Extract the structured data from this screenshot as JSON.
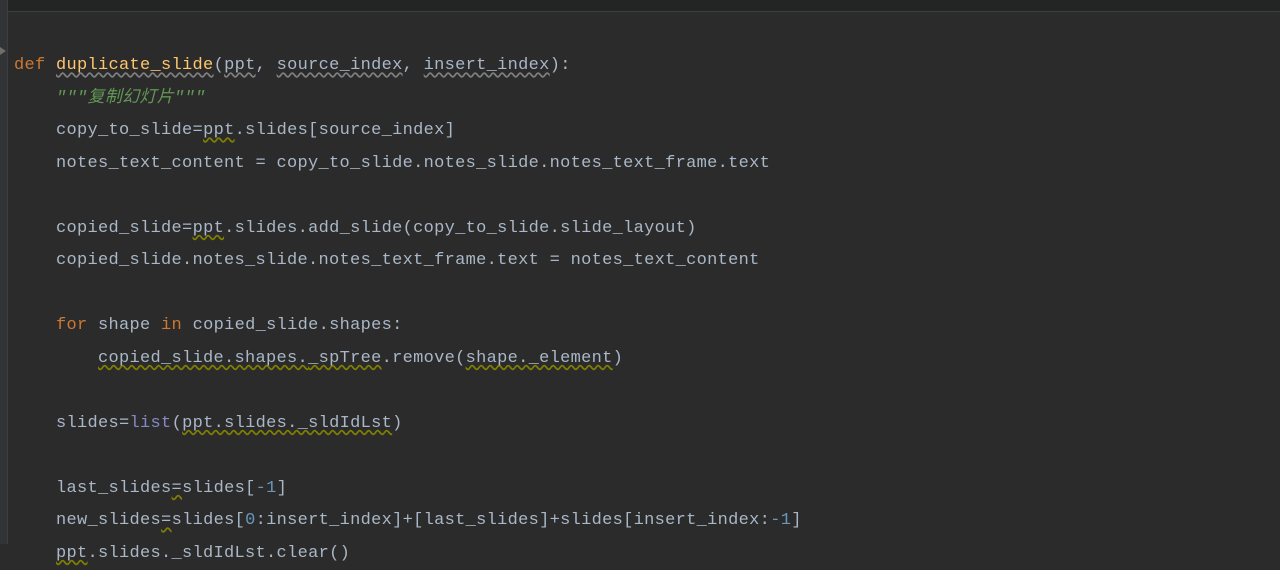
{
  "code": {
    "line1_def": "def",
    "line1_space": " ",
    "line1_fname": "duplicate_slide",
    "line1_open": "(",
    "line1_param1": "ppt",
    "line1_comma1": ", ",
    "line1_param2": "source_index",
    "line1_comma2": ", ",
    "line1_param3": "insert_index",
    "line1_close": "):",
    "line2_doc": "\"\"\"复制幻灯片\"\"\"",
    "line3_a": "copy_to_slide",
    "line3_eq": "=",
    "line3_b": "ppt",
    "line3_dot1": ".slides[source_index]",
    "line4_a": "notes_text_content = copy_to_slide.notes_slide.notes_text_frame.text",
    "line6_a": "copied_slide",
    "line6_eq": "=",
    "line6_b": "ppt",
    "line6_c": ".slides.add_slide(copy_to_slide.slide_layout)",
    "line7": "copied_slide.notes_slide.notes_text_frame.text = notes_text_content",
    "line9_for": "for",
    "line9_shape": " shape ",
    "line9_in": "in",
    "line9_rest": " copied_slide.shapes:",
    "line10_a": "copied_slide.shapes.",
    "line10_b": "_spTree",
    "line10_c": ".remove(",
    "line10_d": "shape._element",
    "line10_e": ")",
    "line12_a": "slides",
    "line12_eq": "=",
    "line12_b": "list",
    "line12_open": "(",
    "line12_c": "ppt.slides._sldIdLst",
    "line12_close": ")",
    "line14_a": "last_slides",
    "line14_eq": "=",
    "line14_b": "slides[",
    "line14_num": "-1",
    "line14_close": "]",
    "line15_a": "new_slides",
    "line15_eq": "=",
    "line15_b": "slides[",
    "line15_num0": "0",
    "line15_c": ":insert_index]+[last_slides]+slides[insert_index:",
    "line15_num1": "-1",
    "line15_d": "]",
    "line16_a": "ppt",
    "line16_b": ".slides._sldIdLst.clear()",
    "indent1": "    ",
    "indent2": "        "
  }
}
